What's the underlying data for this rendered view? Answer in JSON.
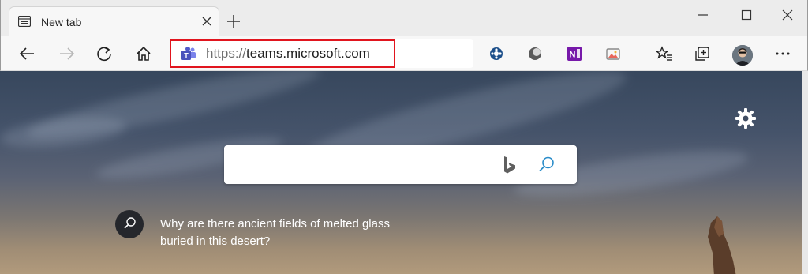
{
  "tab": {
    "title": "New tab",
    "favicon_icon": "new-tab-page-icon",
    "close_icon": "close-icon"
  },
  "new_tab_icon": "plus-icon",
  "window_controls": [
    "minimize-icon",
    "maximize-icon",
    "close-icon"
  ],
  "toolbar": {
    "back_icon": "back-arrow-icon",
    "forward_icon": "forward-arrow-icon",
    "refresh_icon": "refresh-icon",
    "home_icon": "home-icon",
    "address": {
      "favicon": "teams-icon",
      "scheme": "https://",
      "host": "teams.microsoft.com"
    },
    "extensions": [
      "extension-blue-icon",
      "extension-gray-icon",
      "onenote-icon",
      "image-extension-icon"
    ],
    "favorites_icon": "favorites-list-icon",
    "collections_icon": "collections-icon",
    "profile_icon": "avatar",
    "menu_icon": "more-icon"
  },
  "colors": {
    "highlight": "#e1151e",
    "teams": "#5059c9",
    "search_accent": "#2a8cc9"
  },
  "content": {
    "settings_icon": "gear-icon",
    "search_placeholder": "",
    "bing_icon": "bing-icon",
    "search_icon": "search-icon",
    "fact": {
      "icon": "search-icon",
      "text": "Why are there ancient fields of melted glass buried in this desert?"
    }
  }
}
